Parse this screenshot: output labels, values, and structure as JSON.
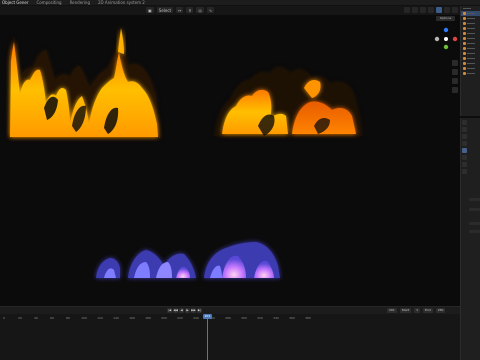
{
  "topbar": {
    "tabs": [
      {
        "label": "Object Gener",
        "active": true
      },
      {
        "label": "Compositing",
        "active": false
      },
      {
        "label": "Rendering",
        "active": false
      },
      {
        "label": "2D Animation system 2",
        "active": false
      }
    ]
  },
  "viewport_header": {
    "select_label": "Select",
    "options_label": "Options"
  },
  "timeline": {
    "start_label": "Start",
    "start_value": "1",
    "end_label": "End",
    "end_value": "250",
    "current_frame": "201",
    "ruler_ticks": [
      "0",
      "20",
      "40",
      "60",
      "80",
      "100",
      "120",
      "140",
      "160",
      "180",
      "200",
      "220",
      "240",
      "260",
      "280",
      "300",
      "320",
      "340",
      "360",
      "380"
    ],
    "controls": [
      "|◀",
      "◀◀",
      "◀",
      "▶",
      "▶▶",
      "▶|"
    ]
  },
  "accent_color": "#4a78b8",
  "icons": [
    "view-icon",
    "cursor-icon",
    "gizmo-x-icon",
    "gizmo-y-icon",
    "gizmo-z-icon",
    "play-icon"
  ]
}
